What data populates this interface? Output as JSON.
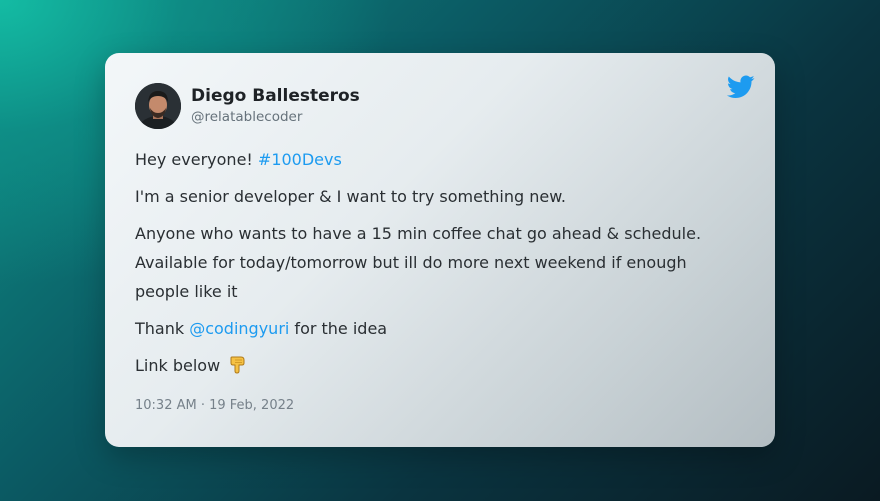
{
  "tweet": {
    "author_name": "Diego Ballesteros",
    "author_handle": "@relatablecoder",
    "line1_text": "Hey everyone! ",
    "hashtag": "#100Devs",
    "line2": "I'm a senior developer & I want to try something new.",
    "line3a": "Anyone who wants to have a 15 min coffee chat go ahead & schedule.",
    "line3b": "Available for today/tomorrow but ill do more next weekend if enough",
    "line3c": "people like it",
    "thanks_prefix": "Thank ",
    "mention": "@codingyuri",
    "thanks_suffix": " for the idea",
    "link_text": "Link below ",
    "timestamp": "10:32 AM · 19 Feb, 2022",
    "icons": {
      "brand": "twitter-bird-icon",
      "emoji": "pointing-down-emoji"
    },
    "colors": {
      "link": "#1d9bf0",
      "brand": "#1d9bf0"
    }
  }
}
